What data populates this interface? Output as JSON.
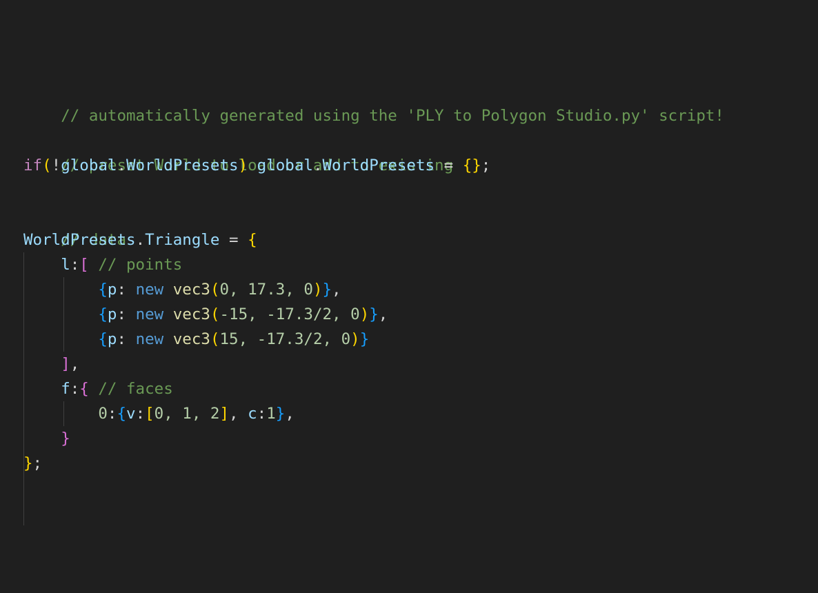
{
  "code": {
    "comment_header": "// automatically generated using the 'PLY to Polygon Studio.py' script!",
    "comment_preset": "// preset World to load or add to existing",
    "kw_if": "if",
    "paren_open": "(",
    "bang": "!",
    "global1": "global",
    "dot": ".",
    "worldpresets": "WorldPresets",
    "paren_close": ")",
    "global2": "global",
    "worldpresets2": "WorldPresets",
    "assign": " = ",
    "empty_obj": "{}",
    "semicolon": ";",
    "comment_data": "// data",
    "triangle_obj": "WorldPresets",
    "triangle_prop": "Triangle",
    "assign2": " = ",
    "brace_open": "{",
    "l_key": "l",
    "colon": ":",
    "bracket_open": "[",
    "comment_points": "// points",
    "points": [
      {
        "key": "p",
        "kw_new": "new",
        "fn": "vec3",
        "args": "0, 17.3, 0",
        "trail": ","
      },
      {
        "key": "p",
        "kw_new": "new",
        "fn": "vec3",
        "args": "-15, -17.3/2, 0",
        "trail": ","
      },
      {
        "key": "p",
        "kw_new": "new",
        "fn": "vec3",
        "args": "15, -17.3/2, 0",
        "trail": ""
      }
    ],
    "bracket_close": "]",
    "comma": ",",
    "f_key": "f",
    "brace_f_open": "{",
    "comment_faces": "// faces",
    "face_index": "0",
    "face_v_key": "v",
    "face_v_list": "0, 1, 2",
    "face_c_key": "c",
    "face_c_val": "1",
    "brace_f_close": "}",
    "brace_close": "}",
    "final_semicolon": ";"
  }
}
